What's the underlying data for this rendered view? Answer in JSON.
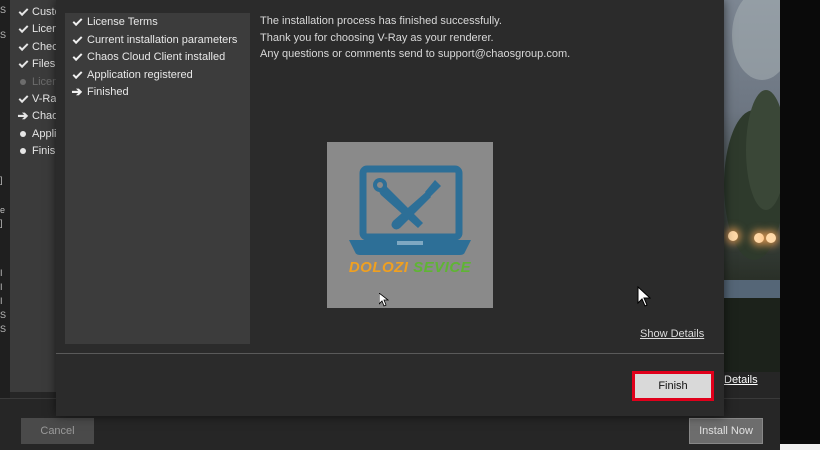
{
  "background_installer": {
    "steps": [
      {
        "label": "Custo",
        "icon": "check-icon",
        "state": "done"
      },
      {
        "label": "Licen",
        "icon": "check-icon",
        "state": "done"
      },
      {
        "label": "Checl",
        "icon": "check-icon",
        "state": "done"
      },
      {
        "label": "Files",
        "icon": "check-icon",
        "state": "done"
      },
      {
        "label": "Licen",
        "icon": "dot-icon",
        "state": "disabled"
      },
      {
        "label": "V-Ray",
        "icon": "check-icon",
        "state": "done"
      },
      {
        "label": "Chaos",
        "icon": "arrow-right-icon",
        "state": "current"
      },
      {
        "label": "Appli",
        "icon": "dot-icon",
        "state": "pending"
      },
      {
        "label": "Finish",
        "icon": "dot-icon",
        "state": "pending"
      }
    ],
    "details_link": "Details",
    "cancel_label": "Cancel",
    "install_label": "Install Now"
  },
  "dialog": {
    "steps": [
      {
        "label": "License Terms",
        "icon": "check-icon"
      },
      {
        "label": "Current installation parameters",
        "icon": "check-icon"
      },
      {
        "label": "Chaos Cloud Client installed",
        "icon": "check-icon"
      },
      {
        "label": "Application registered",
        "icon": "check-icon"
      },
      {
        "label": "Finished",
        "icon": "arrow-right-icon"
      }
    ],
    "messages": {
      "line1": "The installation process has finished successfully.",
      "line2": "Thank you for choosing V-Ray as your renderer.",
      "line3": "Any questions or comments send to support@chaosgroup.com."
    },
    "logo": {
      "word1": "DOLOZI",
      "word2": "SEVICE",
      "icon": "laptop-wrench-icon",
      "colors": {
        "laptop": "#2d6f97",
        "word1": "#f0a020",
        "word2": "#5fb534",
        "box": "#8a8a8a"
      }
    },
    "show_details_label": "Show Details",
    "finish_label": "Finish",
    "highlight_color": "#e0001b"
  }
}
